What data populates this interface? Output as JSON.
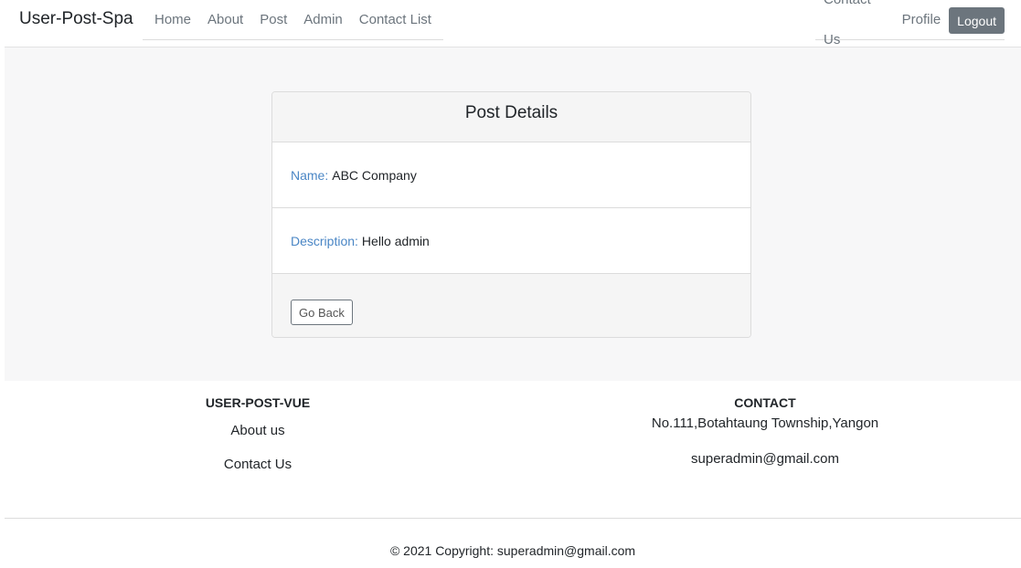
{
  "navbar": {
    "brand": "User-Post-Spa",
    "links": [
      "Home",
      "About",
      "Post",
      "Admin",
      "Contact List"
    ],
    "right_links": [
      "Contact Us",
      "Profile"
    ],
    "logout_label": "Logout"
  },
  "card": {
    "title": "Post Details",
    "name_label": "Name:",
    "name_value": "ABC Company",
    "description_label": "Description:",
    "description_value": "Hello admin",
    "back_label": "Go Back"
  },
  "footer": {
    "left_heading": "USER-POST-VUE",
    "about_link": "About us",
    "contact_link": "Contact Us",
    "right_heading": "CONTACT",
    "address": "No.111,Botahtaung Township,Yangon",
    "email": "superadmin@gmail.com",
    "copyright": "© 2021 Copyright: superadmin@gmail.com"
  },
  "colors": {
    "label_blue": "#4a86c5",
    "logout_gray": "#6c757d",
    "page_bg": "#f7f7f8"
  }
}
